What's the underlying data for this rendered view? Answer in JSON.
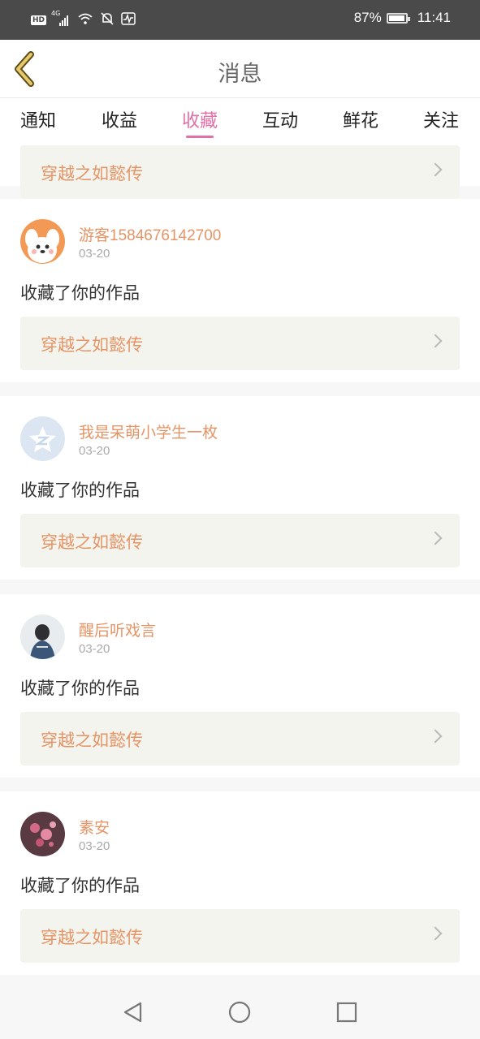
{
  "status_bar": {
    "hd": "HD",
    "network": "4G",
    "battery": "87%",
    "battery_level": 0.87,
    "time": "11:41"
  },
  "header": {
    "title": "消息"
  },
  "tabs": [
    {
      "label": "通知"
    },
    {
      "label": "收益"
    },
    {
      "label": "收藏",
      "active": true
    },
    {
      "label": "互动"
    },
    {
      "label": "鲜花"
    },
    {
      "label": "关注"
    }
  ],
  "feed": {
    "partial_card": {
      "work_title": "穿越之如懿传"
    },
    "cards": [
      {
        "username": "游客1584676142700",
        "date": "03-20",
        "action": "收藏了你的作品",
        "work_title": "穿越之如懿传",
        "avatar_icon": "puppy-avatar-icon"
      },
      {
        "username": "我是呆萌小学生一枚",
        "date": "03-20",
        "action": "收藏了你的作品",
        "work_title": "穿越之如懿传",
        "avatar_icon": "default-star-avatar-icon"
      },
      {
        "username": "醒后听戏言",
        "date": "03-20",
        "action": "收藏了你的作品",
        "work_title": "穿越之如懿传",
        "avatar_icon": "girl-photo-avatar"
      },
      {
        "username": "素安",
        "date": "03-20",
        "action": "收藏了你的作品",
        "work_title": "穿越之如懿传",
        "avatar_icon": "flower-photo-avatar"
      }
    ]
  },
  "colors": {
    "accent": "#e26fa5",
    "username": "#e59466",
    "work_box": "#f4f4ee",
    "status_bar": "#4a4a4a"
  },
  "nav_icons": [
    "back-triangle-icon",
    "home-circle-icon",
    "recents-square-icon"
  ]
}
